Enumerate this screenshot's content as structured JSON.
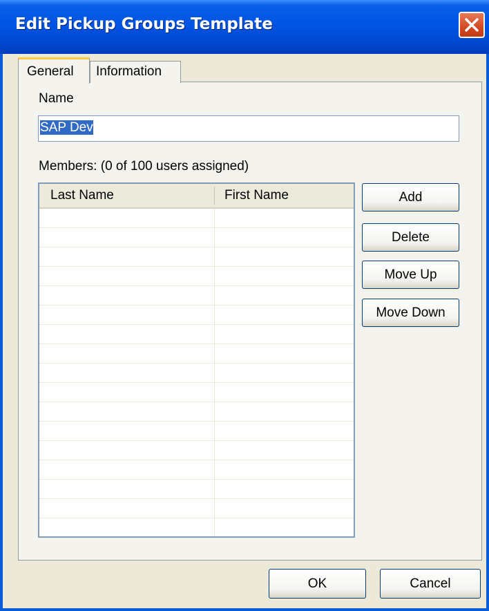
{
  "window": {
    "title": "Edit Pickup Groups Template"
  },
  "tabs": [
    {
      "label": "General"
    },
    {
      "label": "Information"
    }
  ],
  "general": {
    "name_label": "Name",
    "name_value": "SAP Dev",
    "members_label": "Members: (0 of 100 users assigned)",
    "columns": [
      "Last Name",
      "First Name"
    ],
    "rows": []
  },
  "side_buttons": {
    "add": "Add",
    "delete": "Delete",
    "move_up": "Move Up",
    "move_down": "Move Down"
  },
  "footer": {
    "ok": "OK",
    "cancel": "Cancel"
  },
  "colors": {
    "title_bar": "#0054e3",
    "selection": "#316ac5",
    "face": "#ece9d8",
    "close": "#d24a22"
  }
}
